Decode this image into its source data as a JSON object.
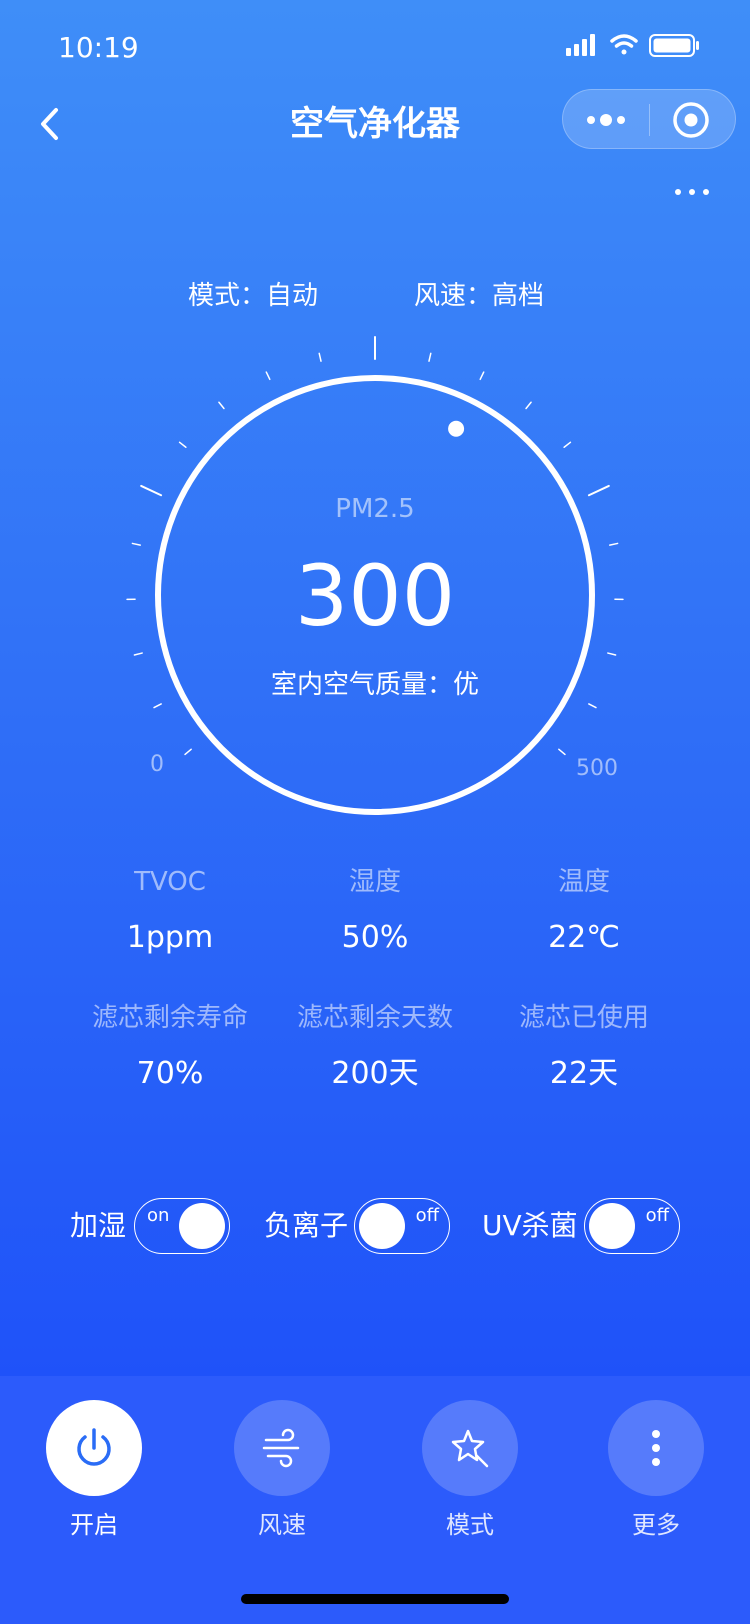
{
  "status_bar": {
    "time": "10:19"
  },
  "nav": {
    "title": "空气净化器"
  },
  "mode": {
    "mode_text": "模式：自动",
    "wind_text": "风速：高档"
  },
  "gauge": {
    "label": "PM2.5",
    "value": "300",
    "value_number": 300,
    "quality_text": "室内空气质量：优",
    "scale_min": "0",
    "scale_max": "500",
    "scale_min_number": 0,
    "scale_max_number": 500
  },
  "stats": [
    {
      "label": "TVOC",
      "value": "1ppm"
    },
    {
      "label": "湿度",
      "value": "50%"
    },
    {
      "label": "温度",
      "value": "22℃"
    },
    {
      "label": "滤芯剩余寿命",
      "value": "70%"
    },
    {
      "label": "滤芯剩余天数",
      "value": "200天"
    },
    {
      "label": "滤芯已使用",
      "value": "22天"
    }
  ],
  "toggles": [
    {
      "label": "加湿",
      "state": "on"
    },
    {
      "label": "负离子",
      "state": "off"
    },
    {
      "label": "UV杀菌",
      "state": "off"
    }
  ],
  "actions": [
    {
      "label": "开启",
      "icon": "power-icon",
      "active": true
    },
    {
      "label": "风速",
      "icon": "wind-icon",
      "active": false
    },
    {
      "label": "模式",
      "icon": "mode-star-icon",
      "active": false
    },
    {
      "label": "更多",
      "icon": "more-vertical-icon",
      "active": false
    }
  ],
  "colors": {
    "background_top": "#3f8ef8",
    "background_bottom": "#1f52f9",
    "bottom_bar": "#2c5bfb",
    "power_icon": "#2a6cf6"
  }
}
